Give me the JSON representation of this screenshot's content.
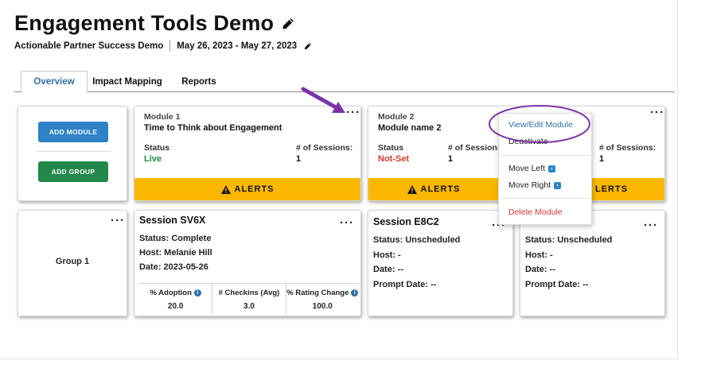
{
  "page": {
    "title": "Engagement Tools Demo",
    "partner": "Actionable Partner Success Demo",
    "date_range": "May 26, 2023 - May 27, 2023"
  },
  "tabs": [
    {
      "label": "Overview",
      "active": true
    },
    {
      "label": "Impact Mapping",
      "active": false
    },
    {
      "label": "Reports",
      "active": false
    }
  ],
  "actions": {
    "add_module": "ADD MODULE",
    "add_group": "ADD GROUP"
  },
  "modules": [
    {
      "label": "Module 1",
      "name": "Time to Think about Engagement",
      "status_label": "Status",
      "status": "Live",
      "sessions_label": "# of Sessions:",
      "sessions": "1",
      "alerts": "ALERTS"
    },
    {
      "label": "Module 2",
      "name": "Module name 2",
      "status_label": "Status",
      "status": "Not-Set",
      "sessions_label": "# of Sessions",
      "sessions": "1",
      "alerts": "ALERTS"
    },
    {
      "sessions_label": "# of Sessions:",
      "sessions": "1",
      "alerts": "LERTS"
    }
  ],
  "group": {
    "name": "Group 1"
  },
  "sessions": [
    {
      "title": "Session SV6X",
      "status": "Status: Complete",
      "host": "Host: Melanie Hill",
      "date": "Date: 2023-05-26",
      "metrics": [
        {
          "label": "% Adoption",
          "value": "20.0",
          "info": true
        },
        {
          "label": "# Checkins (Avg)",
          "value": "3.0",
          "info": false
        },
        {
          "label": "% Rating Change",
          "value": "100.0",
          "info": true
        }
      ]
    },
    {
      "title": "Session E8C2",
      "status": "Status: Unscheduled",
      "host": "Host: -",
      "date": "Date: --",
      "prompt": "Prompt Date: --"
    },
    {
      "status": "Status: Unscheduled",
      "host": "Host: -",
      "date": "Date: --",
      "prompt": "Prompt Date: --"
    }
  ],
  "menu": {
    "view_edit": "View/Edit Module",
    "deactivate": "Deactivate",
    "move_left": "Move Left",
    "move_right": "Move Right",
    "delete": "Delete Module"
  },
  "icons": {
    "edit": "pencil-icon",
    "more": "ellipsis-icon",
    "warning": "warning-icon",
    "info": "info-icon",
    "arrow_left": "chevron-left-icon",
    "arrow_right": "chevron-right-icon"
  },
  "colors": {
    "primary_blue": "#2e82c5",
    "green": "#22894a",
    "alert_yellow": "#fbb800",
    "live_green": "#1e8a3a",
    "notset_red": "#d23a2a",
    "annotation_purple": "#7a34a8"
  }
}
